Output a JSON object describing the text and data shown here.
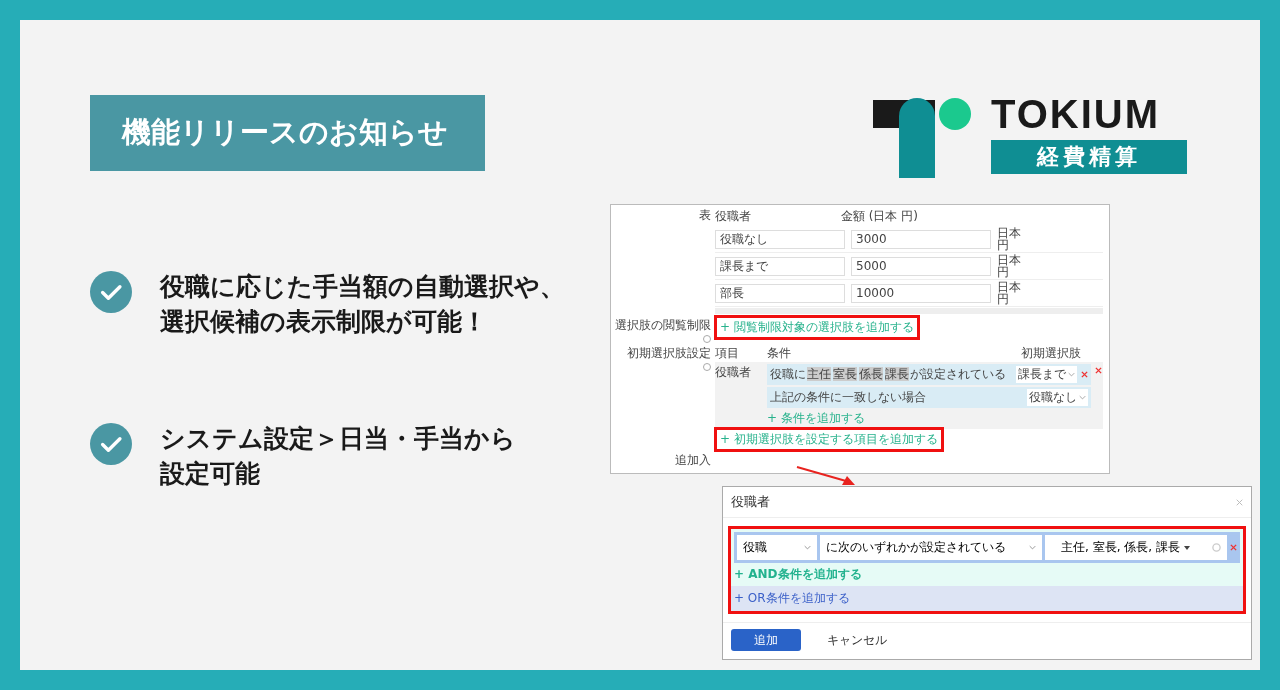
{
  "announcement": {
    "title": "機能リリースのお知らせ"
  },
  "logo": {
    "name": "TOKIUM",
    "product": "経費精算"
  },
  "features": [
    {
      "lines": [
        "役職に応じた手当額の自動選択や、",
        "選択候補の表示制限が可能！"
      ]
    },
    {
      "lines": [
        "システム設定＞日当・手当から",
        "設定可能"
      ]
    }
  ],
  "settings_screen": {
    "table": {
      "label": "表",
      "columns": [
        "役職者",
        "金額 (日本 円)"
      ],
      "rows": [
        {
          "title": "役職なし",
          "amount": "3000",
          "unit": "日本円"
        },
        {
          "title": "課長まで",
          "amount": "5000",
          "unit": "日本円"
        },
        {
          "title": "部長",
          "amount": "10000",
          "unit": "日本円"
        }
      ]
    },
    "view_restriction": {
      "label": "選択肢の閲覧制限",
      "link": "+ 閲覧制限対象の選択肢を追加する"
    },
    "initial_choice": {
      "label": "初期選択肢設定",
      "columns": [
        "項目",
        "条件",
        "初期選択肢"
      ],
      "item": "役職者",
      "conditions": [
        {
          "kind": "match",
          "prefix": "役職に",
          "tags": [
            "主任",
            "室長",
            "係長",
            "課長"
          ],
          "suffix": "が設定されている",
          "value": "課長まで"
        },
        {
          "kind": "fallback",
          "text": "上記の条件に一致しない場合",
          "value": "役職なし"
        }
      ],
      "add_condition": "+ 条件を追加する",
      "add_item": "+ 初期選択肢を設定する項目を追加する"
    },
    "next_label": "追加入"
  },
  "modal": {
    "title": "役職者",
    "field": "役職",
    "operator": "に次のいずれかが設定されている",
    "values": "主任, 室長, 係長, 課長",
    "and_link": "+ AND条件を追加する",
    "or_link": "+ OR条件を追加する",
    "primary_button": "追加",
    "secondary_button": "キャンセル"
  }
}
